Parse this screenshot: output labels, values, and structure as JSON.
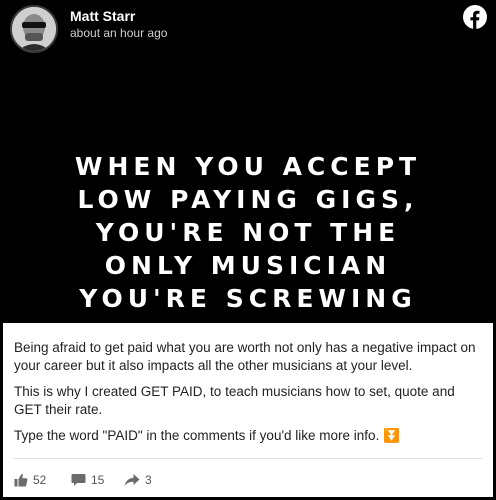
{
  "post": {
    "author": "Matt Starr",
    "timestamp": "about an hour ago",
    "image_text": [
      "WHEN YOU ACCEPT",
      "LOW PAYING GIGS,",
      "YOU'RE NOT THE",
      "ONLY MUSICIAN",
      "YOU'RE SCREWING"
    ],
    "body": [
      "Being afraid to get paid what you are worth not only has a negative impact on your career but it also impacts all the other musicians at your level.",
      "This is why I created GET PAID, to teach musicians how to set, quote and GET their rate.",
      "Type the word \"PAID\" in the comments if you'd like more info. ⏬"
    ],
    "likes": "52",
    "comments": "15",
    "shares": "3"
  },
  "icons": {
    "platform": "facebook-icon",
    "like": "thumbs-up-icon",
    "comment": "comment-bubble-icon",
    "share": "share-arrow-icon"
  },
  "colors": {
    "background": "#000000",
    "text_panel": "#ffffff",
    "body_text": "#222222",
    "meta_text": "#555555"
  }
}
